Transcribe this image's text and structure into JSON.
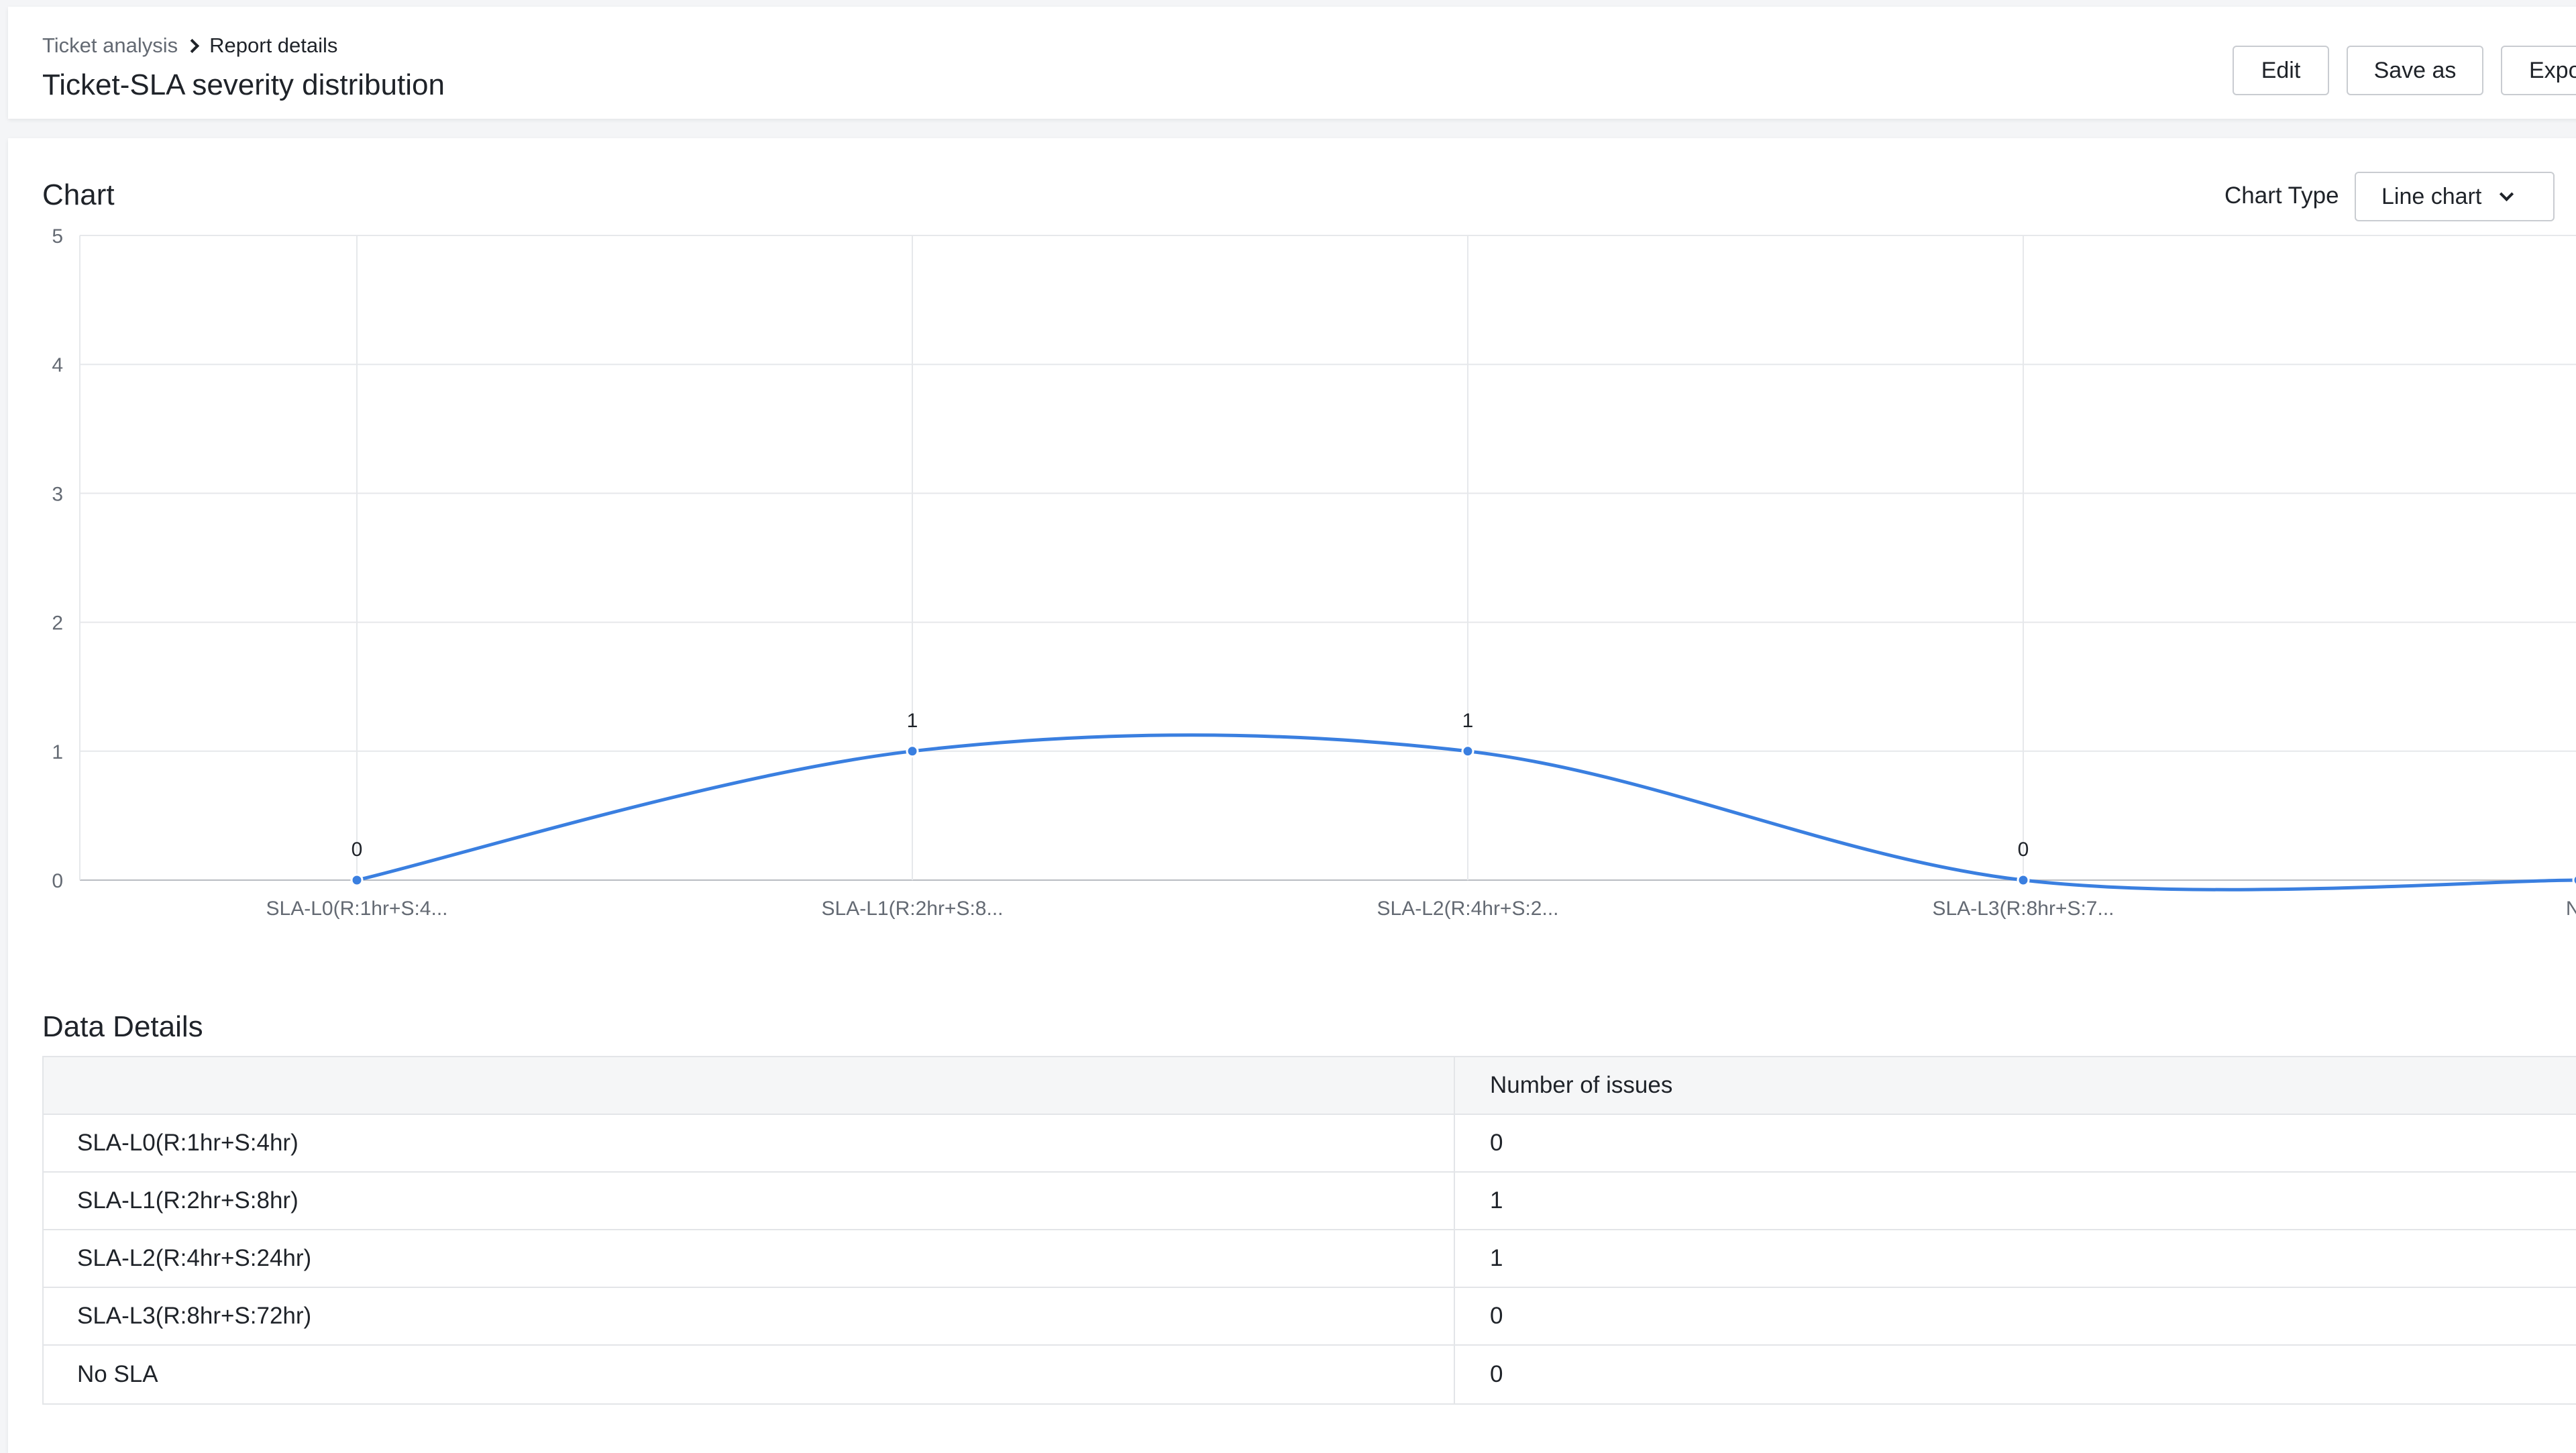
{
  "breadcrumb": {
    "parent": "Ticket analysis",
    "current": "Report details"
  },
  "page_title": "Ticket-SLA severity distribution",
  "actions": {
    "edit": "Edit",
    "save_as": "Save as",
    "export": "Expo"
  },
  "chart_section": {
    "title": "Chart",
    "chart_type_label": "Chart Type",
    "chart_type_value": "Line chart"
  },
  "chart_data": {
    "type": "line",
    "categories": [
      "SLA-L0(R:1hr+S:4...",
      "SLA-L1(R:2hr+S:8...",
      "SLA-L2(R:4hr+S:2...",
      "SLA-L3(R:8hr+S:7...",
      "No"
    ],
    "series": [
      {
        "values": [
          0,
          1,
          1,
          0,
          0
        ]
      }
    ],
    "data_labels": [
      "0",
      "1",
      "1",
      "0",
      ""
    ],
    "yticks": [
      0,
      1,
      2,
      3,
      4,
      5
    ],
    "ylim": [
      0,
      5
    ],
    "grid": true,
    "smooth": true,
    "color": "#3a7fe0"
  },
  "details": {
    "title": "Data Details",
    "header": [
      "",
      "Number of issues"
    ],
    "rows": [
      {
        "name": "SLA-L0(R:1hr+S:4hr)",
        "value": "0"
      },
      {
        "name": "SLA-L1(R:2hr+S:8hr)",
        "value": "1"
      },
      {
        "name": "SLA-L2(R:4hr+S:24hr)",
        "value": "1"
      },
      {
        "name": "SLA-L3(R:8hr+S:72hr)",
        "value": "0"
      },
      {
        "name": "No SLA",
        "value": "0"
      }
    ]
  }
}
